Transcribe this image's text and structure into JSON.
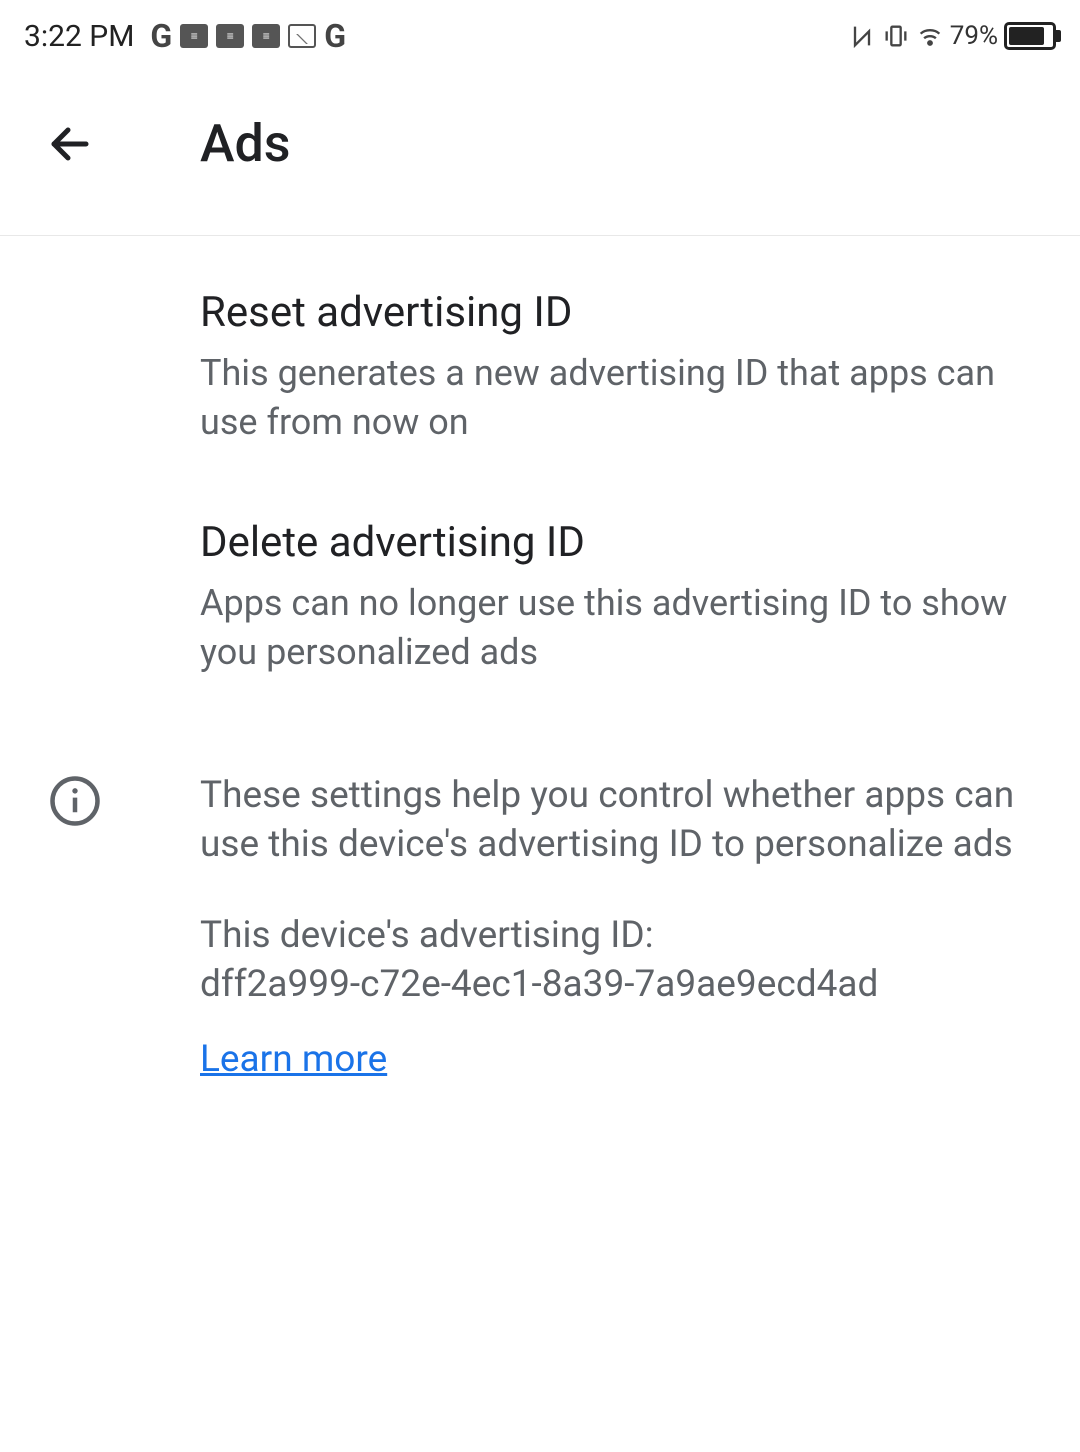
{
  "statusbar": {
    "time": "3:22 PM",
    "battery_pct": "79%"
  },
  "appbar": {
    "title": "Ads"
  },
  "settings": {
    "reset": {
      "title": "Reset advertising ID",
      "desc": "This generates a new advertising ID that apps can use from now on"
    },
    "delete": {
      "title": "Delete advertising ID",
      "desc": "Apps can no longer use this advertising ID to show you personalized ads"
    }
  },
  "info": {
    "explain": "These settings help you control whether apps can use this device's advertising ID to personalize ads",
    "id_label": "This device's advertising ID:",
    "id_value": "dff2a999-c72e-4ec1-8a39-7a9ae9ecd4ad",
    "learn_more": "Learn more"
  }
}
